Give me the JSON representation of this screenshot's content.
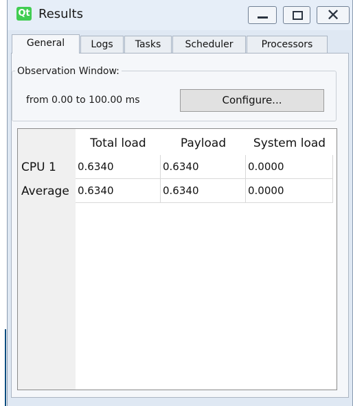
{
  "window": {
    "title": "Results",
    "app_icon_text": "Qt"
  },
  "tabs": [
    {
      "label": "General",
      "active": true
    },
    {
      "label": "Logs",
      "active": false
    },
    {
      "label": "Tasks",
      "active": false
    },
    {
      "label": "Scheduler",
      "active": false
    },
    {
      "label": "Processors",
      "active": false
    }
  ],
  "observation": {
    "group_title": "Observation Window:",
    "range_text": "from 0.00 to 100.00 ms",
    "configure_label": "Configure..."
  },
  "table": {
    "columns": [
      "Total load",
      "Payload",
      "System load"
    ],
    "rows": [
      {
        "label": "CPU 1",
        "values": [
          "0.6340",
          "0.6340",
          "0.0000"
        ]
      },
      {
        "label": "Average",
        "values": [
          "0.6340",
          "0.6340",
          "0.0000"
        ]
      }
    ]
  },
  "colors": {
    "accent": "#41cd52",
    "titlebar": "#e6eef8",
    "frame": "#dfe8f3"
  },
  "icons": {
    "app": "qt-logo-icon",
    "minimize": "minimize-icon",
    "maximize": "maximize-icon",
    "close": "close-icon"
  }
}
